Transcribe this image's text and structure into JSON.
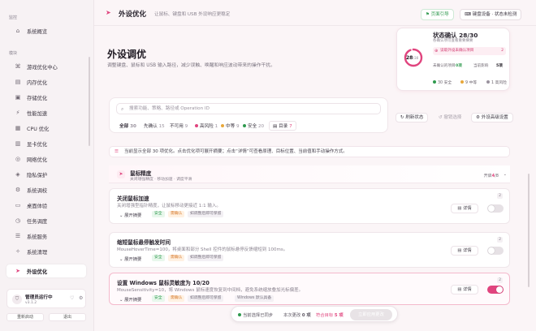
{
  "sidebar": {
    "section_monitor": "监控",
    "section_modules": "模块",
    "items": [
      {
        "label": "系统概览",
        "icon": "home-icon"
      },
      {
        "label": "游戏优化中心",
        "icon": "gamepad-icon"
      },
      {
        "label": "内存优化",
        "icon": "memory-icon"
      },
      {
        "label": "存储优化",
        "icon": "storage-icon"
      },
      {
        "label": "性能加速",
        "icon": "speed-icon"
      },
      {
        "label": "CPU 优化",
        "icon": "cpu-icon"
      },
      {
        "label": "显卡优化",
        "icon": "gpu-icon"
      },
      {
        "label": "网络优化",
        "icon": "network-icon"
      },
      {
        "label": "隐私保护",
        "icon": "shield-icon"
      },
      {
        "label": "系统调校",
        "icon": "tune-icon"
      },
      {
        "label": "桌面体验",
        "icon": "desktop-icon"
      },
      {
        "label": "任务调度",
        "icon": "schedule-icon"
      },
      {
        "label": "系统服务",
        "icon": "service-icon"
      },
      {
        "label": "系统清理",
        "icon": "clean-icon"
      },
      {
        "label": "外设优化",
        "icon": "cursor-icon",
        "active": true
      }
    ],
    "user": {
      "name": "管理员运行中",
      "version": "v3.1.2"
    },
    "restart_label": "重新启动",
    "exit_label": "退出"
  },
  "topbar": {
    "title": "外设优化",
    "subtitle": "让鼠标、键盘和 USB 外设响应更稳定",
    "guide_label": "页面引导",
    "device_label": "键盘设备 · 状态未检测"
  },
  "hero": {
    "title": "外设调优",
    "description": "调整键盘、鼠标和 USB 输入路径，减少误触、唤醒和响应波动带来的操作干扰。"
  },
  "status": {
    "title": "状态确认 28/30",
    "subtitle": "各确认项可查看重要摘要",
    "circle_value": "28",
    "circle_total": "/30",
    "progress": 0.933,
    "pill_text": "读取外设未确认项目",
    "pill_count": "2",
    "row_label": "未确认的项目",
    "row_value": "0项",
    "row_label2": "当前影响",
    "row_value2": "5项",
    "legend": [
      {
        "text": "30 安全",
        "color": "#2f9a4e"
      },
      {
        "text": "9 中等",
        "color": "#e8a83a"
      },
      {
        "text": "1 高风险",
        "color": "#9a929e"
      }
    ]
  },
  "search": {
    "placeholder": "搜索功能、策略、路径或 Operation ID",
    "filters": [
      {
        "label": "全部",
        "count": "30"
      },
      {
        "label": "先确认",
        "count": "15"
      },
      {
        "label": "不可用",
        "count": "9"
      },
      {
        "label": "高风险",
        "count": "1"
      },
      {
        "label": "中等",
        "count": "9"
      },
      {
        "label": "安全",
        "count": "20"
      },
      {
        "label": "目录",
        "count": "7"
      }
    ]
  },
  "actions": {
    "refresh": "刷新状态",
    "revoke": "撤销选择",
    "advanced": "外设高级设置"
  },
  "notice": "当前显示全部 30 项优化。点击优化项可展开摘要；点击“详情”可查看原理、目标位置、当前值和手动操作方式。",
  "group": {
    "title": "鼠标精度",
    "subtitle": "关闭增强精度 · 移动加速 · 调度平滑",
    "count_prefix": "开启",
    "count_on": "4",
    "count_total": "/8"
  },
  "cards": [
    {
      "title": "关闭鼠标加速",
      "desc": "关闭增强型指针精度，让鼠标移动更接近 1:1 输入。",
      "expand": "展开摘要",
      "tags": [
        "安全",
        "需确认",
        "如调整后即可保留"
      ],
      "badge": "2",
      "detail": "详情",
      "on": false
    },
    {
      "title": "缩短鼠标悬停触发时间",
      "desc": "MouseHoverTime=100，将桌面和部分 Shell 控件的鼠标悬停反馈缩短到 100ms。",
      "expand": "展开摘要",
      "tags": [
        "安全",
        "需确认",
        "如调整后即可保留"
      ],
      "badge": "2",
      "detail": "详情",
      "on": false
    },
    {
      "title": "设置 Windows 鼠标灵敏度为 10/20",
      "desc": "MouseSensitivity=10，将 Windows 鼠标速度恢复到中间档，避免系统缩放叠加光标偏差。",
      "expand": "展开摘要",
      "tags": [
        "安全",
        "需确认",
        "如调整后即可保留",
        "Windows 默认具备"
      ],
      "badge": "2",
      "detail": "详情",
      "on": true
    }
  ],
  "bottom": {
    "selected": "当前选择已同步",
    "changes_label": "本次更改",
    "changes_value": "0 项",
    "pending_label": "符合目标",
    "pending_value": "5 项",
    "apply_label": "立即应用更改"
  },
  "colors": {
    "accent": "#e0447e",
    "safe": "#2f9a4e",
    "warn": "#d6782a"
  }
}
